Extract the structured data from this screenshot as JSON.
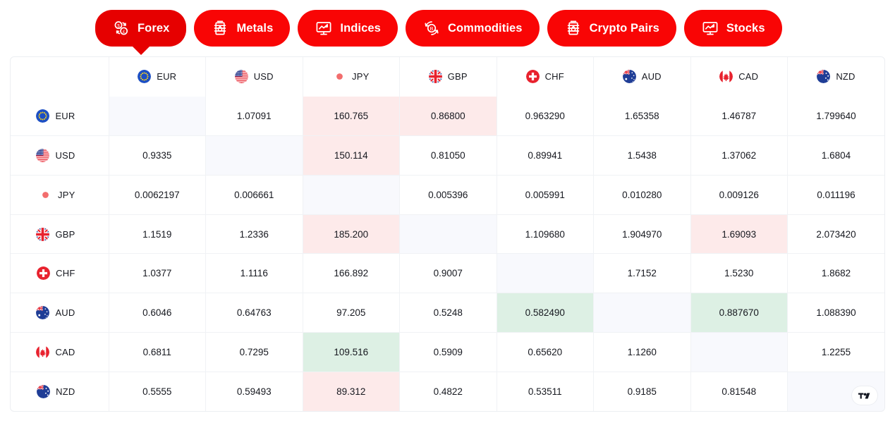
{
  "tabs": [
    {
      "label": "Forex",
      "icon": "currency-exchange-icon",
      "active": true
    },
    {
      "label": "Metals",
      "icon": "oil-barrel-icon",
      "active": false
    },
    {
      "label": "Indices",
      "icon": "monitor-chart-icon",
      "active": false
    },
    {
      "label": "Commodities",
      "icon": "bitcoin-refresh-icon",
      "active": false
    },
    {
      "label": "Crypto Pairs",
      "icon": "oil-barrel-icon",
      "active": false
    },
    {
      "label": "Stocks",
      "icon": "monitor-chart-icon",
      "active": false
    }
  ],
  "colors": {
    "tab_red": "#f90505",
    "tab_red_active": "#e60000",
    "cell_up": "#ddf0e4",
    "cell_down": "#fdeaea",
    "cell_diagonal": "#f8f9fd",
    "text": "#16181f"
  },
  "badge": {
    "name": "tradingview-logo"
  },
  "table": {
    "corner_label": "",
    "currencies": [
      "EUR",
      "USD",
      "JPY",
      "GBP",
      "CHF",
      "AUD",
      "CAD",
      "NZD"
    ],
    "flags": {
      "EUR": "flag-eu",
      "USD": "flag-us",
      "JPY": "flag-jp",
      "GBP": "flag-gb",
      "CHF": "flag-ch",
      "AUD": "flag-au",
      "CAD": "flag-ca",
      "NZD": "flag-nz"
    },
    "rows": [
      {
        "label": "EUR",
        "cells": [
          {
            "value": "",
            "state": "diagonal"
          },
          {
            "value": "1.07091",
            "state": "neutral"
          },
          {
            "value": "160.765",
            "state": "down"
          },
          {
            "value": "0.86800",
            "state": "down"
          },
          {
            "value": "0.963290",
            "state": "neutral"
          },
          {
            "value": "1.65358",
            "state": "neutral"
          },
          {
            "value": "1.46787",
            "state": "neutral"
          },
          {
            "value": "1.799640",
            "state": "neutral"
          }
        ]
      },
      {
        "label": "USD",
        "cells": [
          {
            "value": "0.9335",
            "state": "neutral"
          },
          {
            "value": "",
            "state": "diagonal"
          },
          {
            "value": "150.114",
            "state": "down"
          },
          {
            "value": "0.81050",
            "state": "neutral"
          },
          {
            "value": "0.89941",
            "state": "neutral"
          },
          {
            "value": "1.5438",
            "state": "neutral"
          },
          {
            "value": "1.37062",
            "state": "neutral"
          },
          {
            "value": "1.6804",
            "state": "neutral"
          }
        ]
      },
      {
        "label": "JPY",
        "cells": [
          {
            "value": "0.0062197",
            "state": "neutral"
          },
          {
            "value": "0.006661",
            "state": "neutral"
          },
          {
            "value": "",
            "state": "diagonal"
          },
          {
            "value": "0.005396",
            "state": "neutral"
          },
          {
            "value": "0.005991",
            "state": "neutral"
          },
          {
            "value": "0.010280",
            "state": "neutral"
          },
          {
            "value": "0.009126",
            "state": "neutral"
          },
          {
            "value": "0.011196",
            "state": "neutral"
          }
        ]
      },
      {
        "label": "GBP",
        "cells": [
          {
            "value": "1.1519",
            "state": "neutral"
          },
          {
            "value": "1.2336",
            "state": "neutral"
          },
          {
            "value": "185.200",
            "state": "down"
          },
          {
            "value": "",
            "state": "diagonal"
          },
          {
            "value": "1.109680",
            "state": "neutral"
          },
          {
            "value": "1.904970",
            "state": "neutral"
          },
          {
            "value": "1.69093",
            "state": "down"
          },
          {
            "value": "2.073420",
            "state": "neutral"
          }
        ]
      },
      {
        "label": "CHF",
        "cells": [
          {
            "value": "1.0377",
            "state": "neutral"
          },
          {
            "value": "1.1116",
            "state": "neutral"
          },
          {
            "value": "166.892",
            "state": "neutral"
          },
          {
            "value": "0.9007",
            "state": "neutral"
          },
          {
            "value": "",
            "state": "diagonal"
          },
          {
            "value": "1.7152",
            "state": "neutral"
          },
          {
            "value": "1.5230",
            "state": "neutral"
          },
          {
            "value": "1.8682",
            "state": "neutral"
          }
        ]
      },
      {
        "label": "AUD",
        "cells": [
          {
            "value": "0.6046",
            "state": "neutral"
          },
          {
            "value": "0.64763",
            "state": "neutral"
          },
          {
            "value": "97.205",
            "state": "neutral"
          },
          {
            "value": "0.5248",
            "state": "neutral"
          },
          {
            "value": "0.582490",
            "state": "up"
          },
          {
            "value": "",
            "state": "diagonal"
          },
          {
            "value": "0.887670",
            "state": "up"
          },
          {
            "value": "1.088390",
            "state": "neutral"
          }
        ]
      },
      {
        "label": "CAD",
        "cells": [
          {
            "value": "0.6811",
            "state": "neutral"
          },
          {
            "value": "0.7295",
            "state": "neutral"
          },
          {
            "value": "109.516",
            "state": "up"
          },
          {
            "value": "0.5909",
            "state": "neutral"
          },
          {
            "value": "0.65620",
            "state": "neutral"
          },
          {
            "value": "1.1260",
            "state": "neutral"
          },
          {
            "value": "",
            "state": "diagonal"
          },
          {
            "value": "1.2255",
            "state": "neutral"
          }
        ]
      },
      {
        "label": "NZD",
        "cells": [
          {
            "value": "0.5555",
            "state": "neutral"
          },
          {
            "value": "0.59493",
            "state": "neutral"
          },
          {
            "value": "89.312",
            "state": "down"
          },
          {
            "value": "0.4822",
            "state": "neutral"
          },
          {
            "value": "0.53511",
            "state": "neutral"
          },
          {
            "value": "0.9185",
            "state": "neutral"
          },
          {
            "value": "0.81548",
            "state": "neutral"
          },
          {
            "value": "",
            "state": "diagonal"
          }
        ]
      }
    ]
  }
}
